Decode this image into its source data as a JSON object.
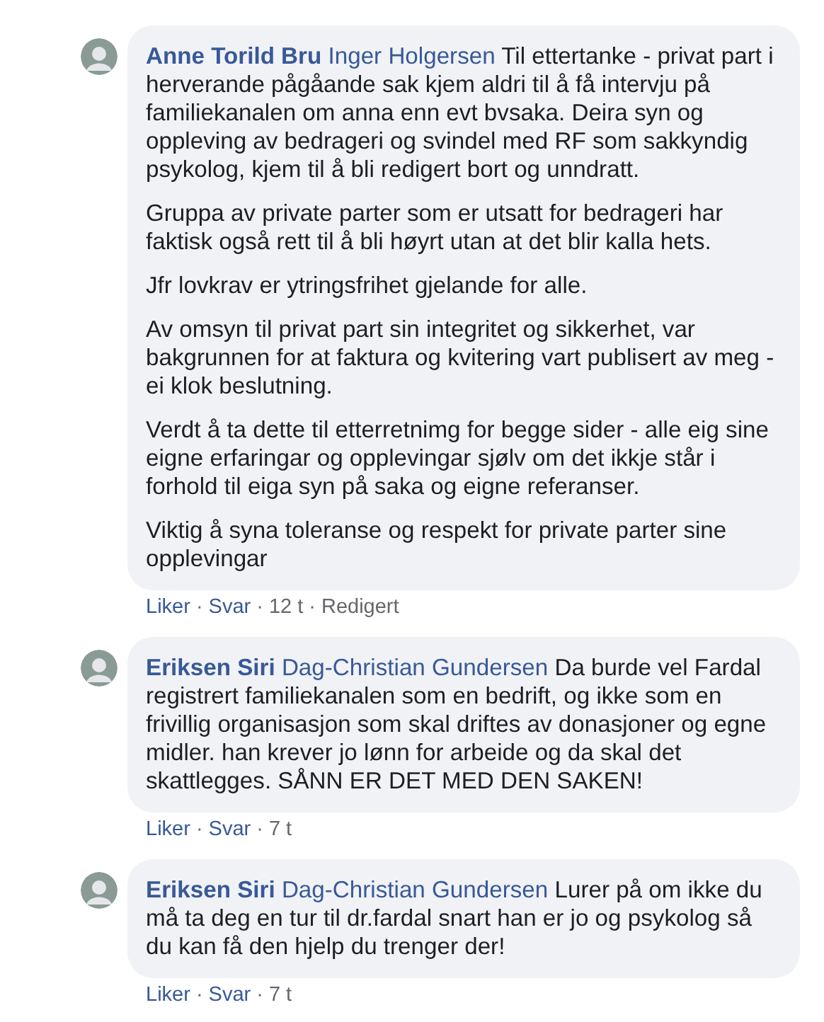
{
  "comments": [
    {
      "author": "Anne Torild Bru",
      "mention": "Inger Holgersen",
      "separator": "·",
      "paragraphs": [
        "Til ettertanke - privat part i herverande pågåande sak kjem aldri til å få intervju på familiekanalen om anna enn evt bvsaka. Deira syn og oppleving av bedrageri og svindel med RF som sakkyndig psykolog, kjem til å bli redigert bort og unndratt.",
        "Gruppa av private parter som er utsatt for bedrageri har faktisk også rett til å bli høyrt utan at det blir kalla hets.",
        "Jfr lovkrav er ytringsfrihet gjelande for alle.",
        "Av omsyn til privat part sin integritet og sikkerhet, var bakgrunnen for at faktura og kvitering vart publisert av meg - ei klok beslutning.",
        "Verdt å ta dette til etterretnimg for begge sider - alle eig sine eigne erfaringar og opplevingar sjølv om det ikkje står i forhold til eiga syn på saka og eigne referanser.",
        "Viktig å syna toleranse og respekt for private parter sine opplevingar"
      ],
      "like": "Liker",
      "reply": "Svar",
      "time": "12 t",
      "edited": "Redigert"
    },
    {
      "author": "Eriksen Siri",
      "mention": "Dag-Christian Gundersen",
      "separator": "·",
      "paragraphs": [
        "Da burde vel Fardal registrert familiekanalen som en bedrift, og ikke som en frivillig organisasjon som skal driftes av donasjoner og egne midler. han krever jo lønn for arbeide og da skal det skattlegges. SÅNN ER DET MED DEN SAKEN!"
      ],
      "like": "Liker",
      "reply": "Svar",
      "time": "7 t"
    },
    {
      "author": "Eriksen Siri",
      "mention": "Dag-Christian Gundersen",
      "separator": "·",
      "paragraphs": [
        "Lurer på om ikke du må ta deg en tur til dr.fardal snart han er jo og psykolog så du kan få den hjelp du trenger der!"
      ],
      "like": "Liker",
      "reply": "Svar",
      "time": "7 t"
    }
  ]
}
